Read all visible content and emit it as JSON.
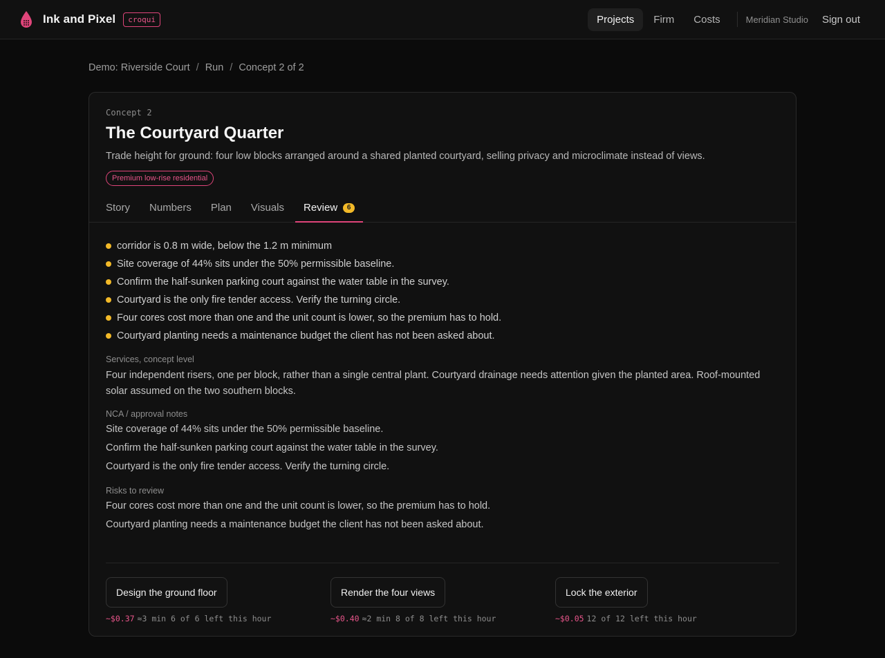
{
  "header": {
    "brand_name": "Ink and Pixel",
    "brand_tag": "croqui",
    "logo_icon": "ink-drop-grid-icon",
    "accent_color": "#e0457a",
    "nav": [
      {
        "label": "Projects",
        "active": true
      },
      {
        "label": "Firm",
        "active": false
      },
      {
        "label": "Costs",
        "active": false
      }
    ],
    "studio": "Meridian Studio",
    "sign_out": "Sign out"
  },
  "breadcrumb": [
    "Demo: Riverside Court",
    "Run",
    "Concept 2 of 2"
  ],
  "concept": {
    "kicker": "Concept 2",
    "title": "The Courtyard Quarter",
    "subtitle": "Trade height for ground: four low blocks arranged around a shared planted courtyard, selling privacy and microclimate instead of views.",
    "pill": "Premium low-rise residential"
  },
  "tabs": [
    {
      "label": "Story",
      "active": false
    },
    {
      "label": "Numbers",
      "active": false
    },
    {
      "label": "Plan",
      "active": false
    },
    {
      "label": "Visuals",
      "active": false
    },
    {
      "label": "Review",
      "active": true,
      "badge": "6"
    }
  ],
  "review": {
    "warning_color": "#f2b928",
    "issues": [
      "corridor is 0.8 m wide, below the 1.2 m minimum",
      "Site coverage of 44% sits under the 50% permissible baseline.",
      "Confirm the half-sunken parking court against the water table in the survey.",
      "Courtyard is the only fire tender access. Verify the turning circle.",
      "Four cores cost more than one and the unit count is lower, so the premium has to hold.",
      "Courtyard planting needs a maintenance budget the client has not been asked about."
    ],
    "services": {
      "label": "Services, concept level",
      "text": "Four independent risers, one per block, rather than a single central plant. Courtyard drainage needs attention given the planted area. Roof-mounted solar assumed on the two southern blocks."
    },
    "nca": {
      "label": "NCA / approval notes",
      "lines": [
        "Site coverage of 44% sits under the 50% permissible baseline.",
        "Confirm the half-sunken parking court against the water table in the survey.",
        "Courtyard is the only fire tender access. Verify the turning circle."
      ]
    },
    "risks": {
      "label": "Risks to review",
      "lines": [
        "Four cores cost more than one and the unit count is lower, so the premium has to hold.",
        "Courtyard planting needs a maintenance budget the client has not been asked about."
      ]
    }
  },
  "actions": [
    {
      "label": "Design the ground floor",
      "cost": "~$0.37",
      "detail": "≈3 min 6 of 6 left this hour"
    },
    {
      "label": "Render the four views",
      "cost": "~$0.40",
      "detail": "≈2 min 8 of 8 left this hour"
    },
    {
      "label": "Lock the exterior",
      "cost": "~$0.05",
      "detail": "12 of 12 left this hour"
    }
  ]
}
